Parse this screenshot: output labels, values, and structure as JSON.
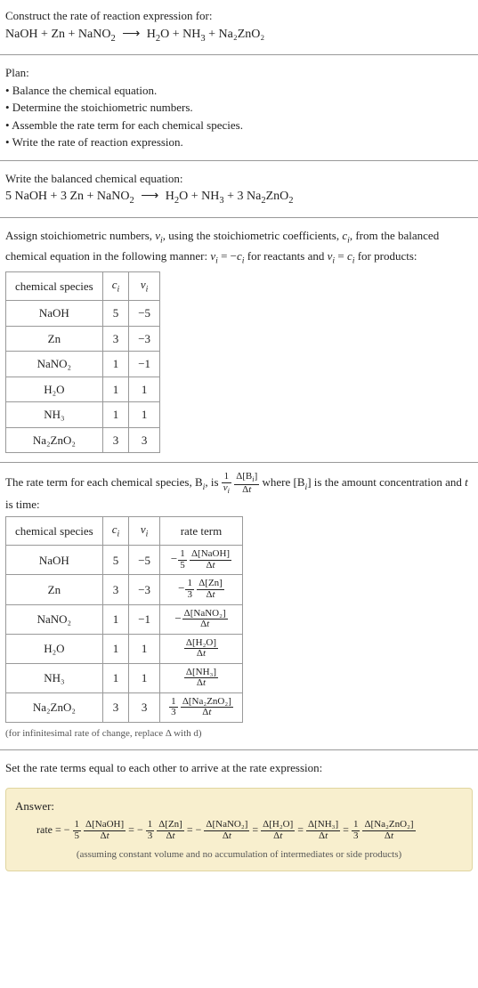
{
  "prompt": "Construct the rate of reaction expression for:",
  "eq_lhs": "NaOH + Zn + NaNO",
  "eq_lhs_sub": "2",
  "arrow": "⟶",
  "eq_rhs": "H",
  "eq_rhs2": "O + NH",
  "eq_rhs3": " + Na₂ZnO₂",
  "plan_title": "Plan:",
  "plan": [
    "• Balance the chemical equation.",
    "• Determine the stoichiometric numbers.",
    "• Assemble the rate term for each chemical species.",
    "• Write the rate of reaction expression."
  ],
  "balanced_title": "Write the balanced chemical equation:",
  "balanced_lhs": "5 NaOH + 3 Zn + NaNO",
  "balanced_rhs": "H",
  "balanced_rhs2": "O + NH",
  "balanced_rhs3": " + 3 Na",
  "balanced_rhs4": "ZnO",
  "stoich_intro1": "Assign stoichiometric numbers, ",
  "stoich_intro2": ", using the stoichiometric coefficients, ",
  "stoich_intro3": ", from the balanced chemical equation in the following manner: ",
  "stoich_intro4": " for reactants and ",
  "stoich_intro5": " for products:",
  "nu": "ν",
  "c": "c",
  "i": "i",
  "eq_reactants": " = −",
  "eq_products": " = ",
  "table1": {
    "headers": [
      "chemical species",
      "cᵢ",
      "νᵢ"
    ],
    "rows": [
      [
        "NaOH",
        "5",
        "−5"
      ],
      [
        "Zn",
        "3",
        "−3"
      ],
      [
        "NaNO₂",
        "1",
        "−1"
      ],
      [
        "H₂O",
        "1",
        "1"
      ],
      [
        "NH₃",
        "1",
        "1"
      ],
      [
        "Na₂ZnO₂",
        "3",
        "3"
      ]
    ]
  },
  "rate_intro1": "The rate term for each chemical species, B",
  "rate_intro2": ", is ",
  "rate_intro3": " where [B",
  "rate_intro4": "] is the amount concentration and ",
  "rate_intro5": " is time:",
  "t": "t",
  "delta": "Δ",
  "table2": {
    "headers": [
      "chemical species",
      "cᵢ",
      "νᵢ",
      "rate term"
    ],
    "rows": [
      {
        "species": "NaOH",
        "c": "5",
        "v": "−5",
        "coef_num": "1",
        "coef_den": "5",
        "dnum": "Δ[NaOH]",
        "dden": "Δt",
        "neg": true
      },
      {
        "species": "Zn",
        "c": "3",
        "v": "−3",
        "coef_num": "1",
        "coef_den": "3",
        "dnum": "Δ[Zn]",
        "dden": "Δt",
        "neg": true
      },
      {
        "species": "NaNO₂",
        "c": "1",
        "v": "−1",
        "coef_num": "",
        "coef_den": "",
        "dnum": "Δ[NaNO₂]",
        "dden": "Δt",
        "neg": true
      },
      {
        "species": "H₂O",
        "c": "1",
        "v": "1",
        "coef_num": "",
        "coef_den": "",
        "dnum": "Δ[H₂O]",
        "dden": "Δt",
        "neg": false
      },
      {
        "species": "NH₃",
        "c": "1",
        "v": "1",
        "coef_num": "",
        "coef_den": "",
        "dnum": "Δ[NH₃]",
        "dden": "Δt",
        "neg": false
      },
      {
        "species": "Na₂ZnO₂",
        "c": "3",
        "v": "3",
        "coef_num": "1",
        "coef_den": "3",
        "dnum": "Δ[Na₂ZnO₂]",
        "dden": "Δt",
        "neg": false
      }
    ]
  },
  "inf_note": "(for infinitesimal rate of change, replace Δ with d)",
  "final_prompt": "Set the rate terms equal to each other to arrive at the rate expression:",
  "answer_label": "Answer:",
  "rate_label": "rate = ",
  "equals": " = ",
  "answer_note": "(assuming constant volume and no accumulation of intermediates or side products)",
  "chart_data": {
    "type": "table",
    "title": "Stoichiometric numbers and rate terms",
    "tables": [
      {
        "columns": [
          "chemical species",
          "c_i",
          "nu_i"
        ],
        "rows": [
          [
            "NaOH",
            5,
            -5
          ],
          [
            "Zn",
            3,
            -3
          ],
          [
            "NaNO2",
            1,
            -1
          ],
          [
            "H2O",
            1,
            1
          ],
          [
            "NH3",
            1,
            1
          ],
          [
            "Na2ZnO2",
            3,
            3
          ]
        ]
      },
      {
        "columns": [
          "chemical species",
          "c_i",
          "nu_i",
          "rate term"
        ],
        "rows": [
          [
            "NaOH",
            5,
            -5,
            "-(1/5) d[NaOH]/dt"
          ],
          [
            "Zn",
            3,
            -3,
            "-(1/3) d[Zn]/dt"
          ],
          [
            "NaNO2",
            1,
            -1,
            "- d[NaNO2]/dt"
          ],
          [
            "H2O",
            1,
            1,
            "d[H2O]/dt"
          ],
          [
            "NH3",
            1,
            1,
            "d[NH3]/dt"
          ],
          [
            "Na2ZnO2",
            3,
            3,
            "(1/3) d[Na2ZnO2]/dt"
          ]
        ]
      }
    ],
    "rate_expression": "rate = -(1/5) d[NaOH]/dt = -(1/3) d[Zn]/dt = - d[NaNO2]/dt = d[H2O]/dt = d[NH3]/dt = (1/3) d[Na2ZnO2]/dt"
  }
}
